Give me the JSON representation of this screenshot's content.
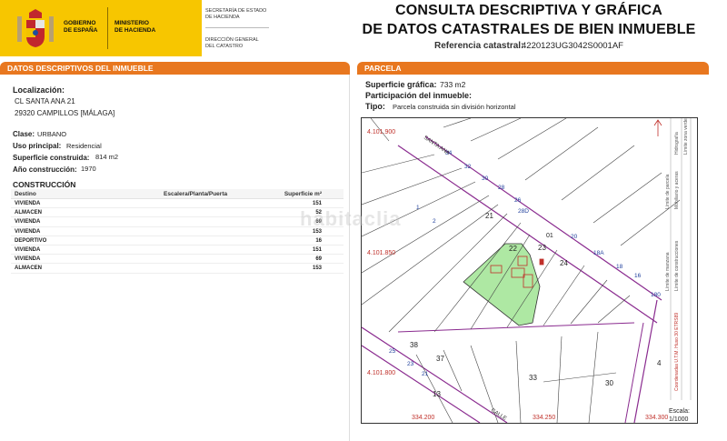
{
  "header": {
    "gov_line1": "GOBIERNO",
    "gov_line2": "DE ESPAÑA",
    "min_line1": "MINISTERIO",
    "min_line2": "DE HACIENDA",
    "sec_line1": "SECRETARÍA DE ESTADO",
    "sec_line2": "DE HACIENDA",
    "dg_line1": "DIRECCIÓN GENERAL",
    "dg_line2": "DEL CATASTRO",
    "title_line1": "CONSULTA DESCRIPTIVA Y GRÁFICA",
    "title_line2": "DE DATOS CATASTRALES DE BIEN INMUEBLE",
    "ref_label": "Referencia catastral:",
    "ref_value": "4220123UG3042S0001AF"
  },
  "left": {
    "bar": "DATOS DESCRIPTIVOS DEL INMUEBLE",
    "localizacion_label": "Localización:",
    "address_line1": "CL SANTA ANA 21",
    "address_line2": "29320 CAMPILLOS [MÁLAGA]",
    "clase_label": "Clase:",
    "clase_value": "URBANO",
    "uso_label": "Uso principal:",
    "uso_value": "Residencial",
    "sup_label": "Superficie construida:",
    "sup_value": "814 m2",
    "ano_label": "Año construcción:",
    "ano_value": "1970",
    "construccion_label": "CONSTRUCCIÓN",
    "table": {
      "headers": {
        "destino": "Destino",
        "escalera": "Escalera/Planta/Puerta",
        "superficie": "Superficie m²"
      },
      "rows": [
        {
          "destino": "VIVIENDA",
          "superficie": "151"
        },
        {
          "destino": "ALMACEN",
          "superficie": "52"
        },
        {
          "destino": "VIVIENDA",
          "superficie": "69"
        },
        {
          "destino": "VIVIENDA",
          "superficie": "153"
        },
        {
          "destino": "DEPORTIVO",
          "superficie": "16"
        },
        {
          "destino": "VIVIENDA",
          "superficie": "151"
        },
        {
          "destino": "VIVIENDA",
          "superficie": "69"
        },
        {
          "destino": "ALMACEN",
          "superficie": "153"
        }
      ]
    }
  },
  "right": {
    "bar": "PARCELA",
    "sup_grafica_label": "Superficie gráfica:",
    "sup_grafica_value": "733 m2",
    "participacion_label": "Participación del inmueble:",
    "tipo_label": "Tipo:",
    "tipo_value": "Parcela construida sin división horizontal",
    "map": {
      "coord_top": "4.101.900",
      "coord_mid": "4.101.850",
      "coord_low": "4.101.800",
      "coord_bottom_left": "334.200",
      "coord_bottom_mid": "334.250",
      "coord_bottom_right": "334.300",
      "parcel_numbers": [
        "21",
        "22",
        "23",
        "24",
        "01",
        "38",
        "37",
        "13",
        "33",
        "30",
        "4"
      ],
      "street_numbers": [
        "34",
        "32",
        "28",
        "26",
        "30",
        "28D",
        "20",
        "18",
        "16",
        "18A",
        "180",
        "25",
        "23",
        "21",
        "1",
        "2"
      ],
      "street_names": [
        "SANTA ANA",
        "CALLE"
      ],
      "legend": [
        "Límite de manzana",
        "Límite de parcela",
        "Límite de construcciones",
        "Mobiliario y aceras",
        "Límite zona verde",
        "Hidrografía"
      ],
      "legend_note": "Coordenadas U.T.M. Huso 30 ETRS89",
      "escala_label": "Escala:",
      "escala_value": "1/1000"
    }
  },
  "watermark": "habitaclia",
  "colors": {
    "orange": "#e8771f",
    "yellow": "#f7c600",
    "green_parcel": "#aee8a3",
    "line_red": "#c0302a",
    "line_purple": "#8a2b8f"
  }
}
